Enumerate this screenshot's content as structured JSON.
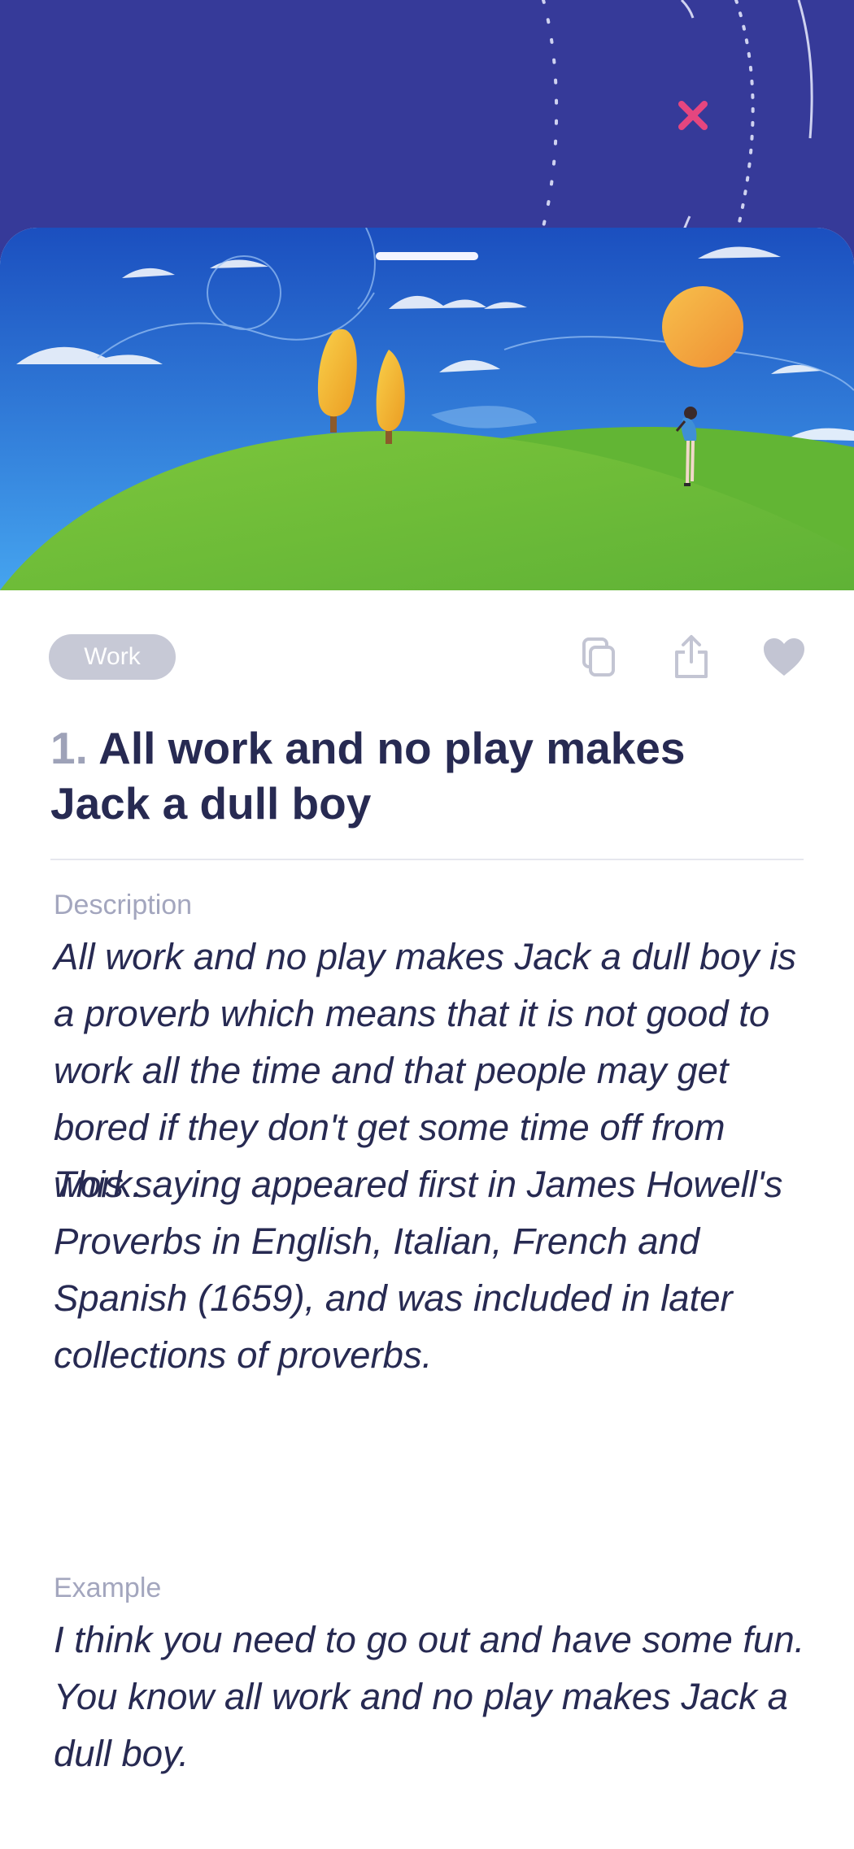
{
  "header": {
    "close_icon": "close-x-icon",
    "close_color": "#e5467f"
  },
  "card": {
    "category": "Work",
    "actions": [
      {
        "icon": "copy-icon"
      },
      {
        "icon": "share-icon"
      },
      {
        "icon": "heart-icon"
      }
    ],
    "number": "1.",
    "title": "All work and no play makes Jack a dull boy",
    "description_label": "Description",
    "description_p1": "All work and no play makes Jack a dull boy is a proverb which means that it is not good to work all the time and that people may get bored if they don't get some time off from work.",
    "description_p2": "This saying appeared first in James Howell's Proverbs in English, Italian, French and Spanish (1659), and was included in later collections of proverbs.",
    "example_label": "Example",
    "example_text": "I think you need to go out and have some fun. You know all work and no play makes Jack a dull boy."
  },
  "colors": {
    "top_background": "#363a99",
    "sky": "#2f7fdc",
    "hill": "#6dbd38",
    "sun": "#f3a33d",
    "title_text": "#272a52",
    "label_text": "#a3a6be",
    "tag_background": "#c7c9d6"
  }
}
